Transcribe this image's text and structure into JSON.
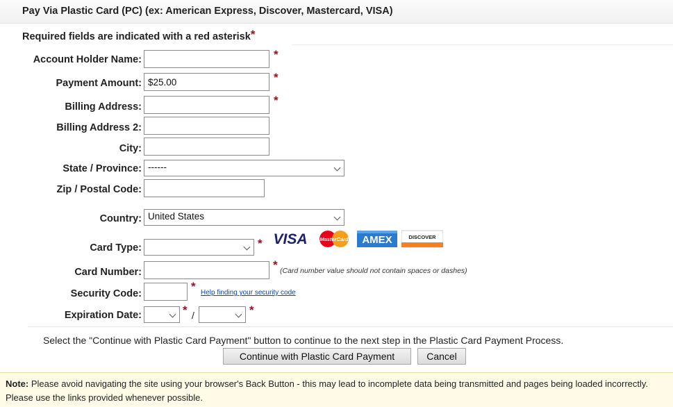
{
  "header": {
    "title": "Pay Via Plastic Card (PC) (ex: American Express, Discover, Mastercard, VISA)"
  },
  "required_note": "Required fields are indicated with a red asterisk",
  "asterisk": "*",
  "form": {
    "account_holder_label": "Account Holder Name:",
    "account_holder_value": "",
    "payment_amount_label": "Payment Amount:",
    "payment_amount_value": "$25.00",
    "billing_address_label": "Billing Address:",
    "billing_address_value": "",
    "billing_address2_label": "Billing Address 2:",
    "billing_address2_value": "",
    "city_label": "City:",
    "city_value": "",
    "state_label": "State / Province:",
    "state_value": "------",
    "zip_label": "Zip / Postal Code:",
    "zip_value": "",
    "country_label": "Country:",
    "country_value": "United States",
    "card_type_label": "Card Type:",
    "card_type_value": "",
    "card_number_label": "Card Number:",
    "card_number_value": "",
    "card_number_hint": "(Card number value should not contain spaces or dashes)",
    "security_code_label": "Security Code:",
    "security_code_value": "",
    "security_help_link": "Help finding your security code",
    "expiration_label": "Expiration Date:",
    "expiration_month": "",
    "expiration_year": "",
    "expiration_sep": "/"
  },
  "card_logos": {
    "visa": "VISA",
    "mastercard": "MasterCard",
    "amex": "AMEX",
    "discover": "DISCOVER"
  },
  "instructions": "Select the \"Continue with Plastic Card Payment\" button to continue to the next step in the Plastic Card Payment Process.",
  "buttons": {
    "continue": "Continue with Plastic Card Payment",
    "cancel": "Cancel"
  },
  "note": {
    "label": "Note:",
    "text": "Please avoid navigating the site using your browser's Back Button - this may lead to incomplete data being transmitted and pages being loaded incorrectly. Please use the links provided whenever possible."
  },
  "colors": {
    "asterisk": "#a0101c",
    "link": "#0645ad",
    "note_background": "#fffbe6"
  }
}
